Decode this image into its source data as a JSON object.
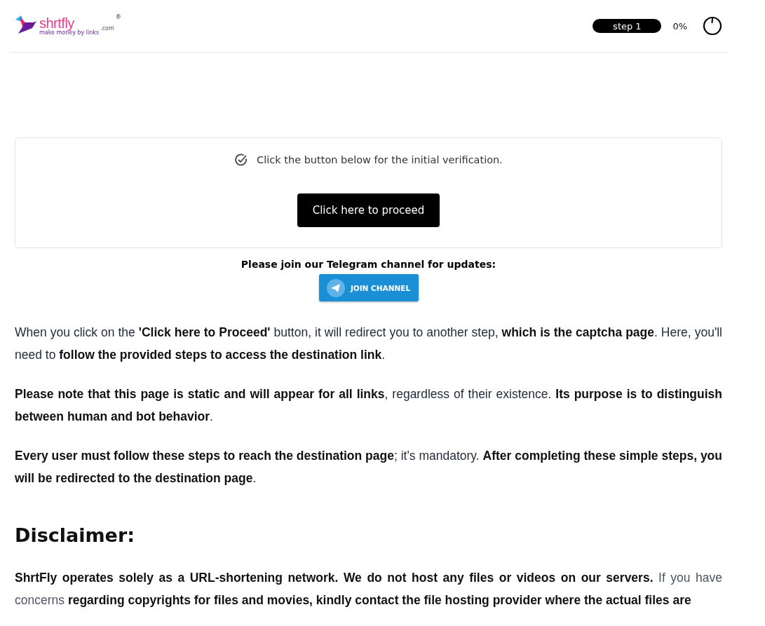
{
  "header": {
    "logo": {
      "name": "shrtfly",
      "suffix": ".com",
      "tagline": "make money by links",
      "mark": "®"
    },
    "step": "step 1",
    "percent": "0%"
  },
  "verification": {
    "message": "Click the button below for the initial verification.",
    "button": "Click here to proceed"
  },
  "telegram": {
    "prompt": "Please join our Telegram channel for updates:",
    "button": "JOIN CHANNEL"
  },
  "paragraphs": [
    "When you click on the **'Click here to Proceed'** button, it will redirect you to another step, **which is the captcha page**. Here, you'll need to **follow the provided steps to access the destination link**.",
    "**Please note that this page is static and will appear for all links**, regardless of their existence. **Its purpose is to distinguish between human and bot behavior**.",
    "**Every user must follow these steps to reach the destination page**; it's mandatory. **After completing these simple steps, you will be redirected to the destination page**."
  ],
  "disclaimer": {
    "heading": "Disclaimer:",
    "text": "**ShrtFly operates solely as a URL-shortening network. We do not host any files or videos on our servers.** If you have concerns **regarding copyrights for files and movies, kindly contact the file hosting provider where the actual files are**"
  }
}
